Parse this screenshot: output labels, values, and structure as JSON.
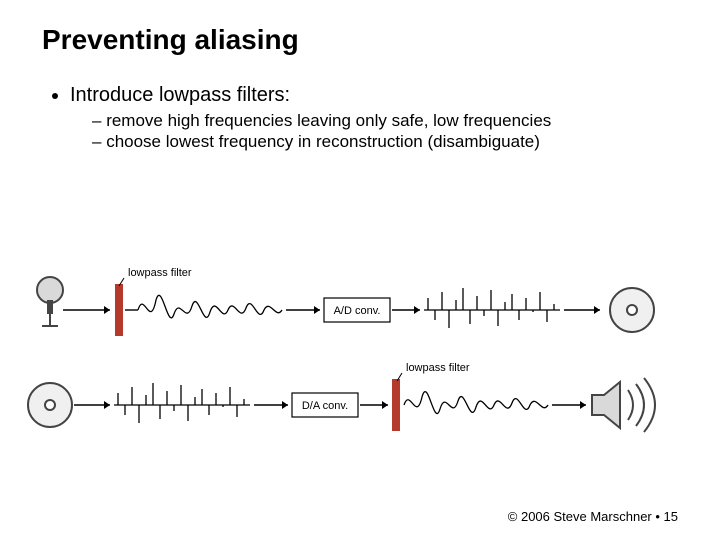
{
  "title": "Preventing aliasing",
  "bullet1": "Introduce lowpass filters:",
  "sub1": "remove high frequencies leaving only safe, low frequencies",
  "sub2": "choose lowest frequency in reconstruction (disambiguate)",
  "labels": {
    "lowpass1": "lowpass filter",
    "lowpass2": "lowpass filter",
    "ad": "A/D conv.",
    "da": "D/A conv."
  },
  "footer": "© 2006 Steve Marschner • 15"
}
